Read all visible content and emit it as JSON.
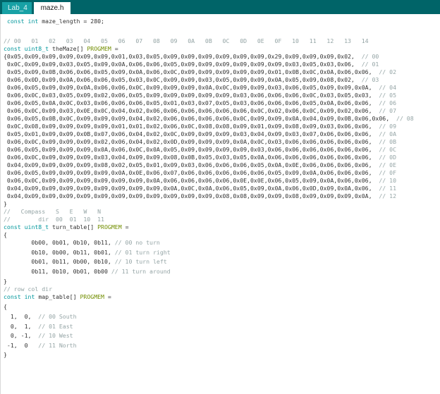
{
  "tabs": [
    {
      "label": "Lab_4",
      "active": false
    },
    {
      "label": "maze.h",
      "active": true
    }
  ],
  "code": {
    "maze_length": " const int maze_length = 280;",
    "col_comment": "// 00   01   02   03   04   05   06   07   08   09   0A   0B   0C   0D   0E   0F   10   11   12   13   14",
    "maze_decl": "const uint8_t theMaze[] PROGMEM =",
    "maze_rows": [
      "{0x05,0x09,0x09,0x09,0x09,0x09,0x01,0x03,0x05,0x09,0x09,0x09,0x09,0x09,0x09,0x29,0x09,0x09,0x09,0x02,  // 00",
      " 0x0C,0x09,0x09,0x03,0x05,0x09,0x0A,0x06,0x06,0x05,0x09,0x09,0x09,0x09,0x09,0x09,0x03,0x05,0x03,0x06,  // 01",
      " 0x05,0x09,0x0B,0x06,0x06,0x05,0x09,0x0A,0x06,0x0C,0x09,0x09,0x09,0x09,0x09,0x01,0x0B,0x0C,0x0A,0x06,0x06,  // 02",
      " 0x06,0x0D,0x09,0x0A,0x06,0x06,0x05,0x03,0x0C,0x09,0x09,0x03,0x05,0x09,0x09,0x0A,0x05,0x09,0x08,0x02,  // 03",
      " 0x06,0x05,0x09,0x09,0x0A,0x06,0x06,0x0C,0x09,0x09,0x09,0x0A,0x0C,0x09,0x09,0x03,0x06,0x05,0x09,0x09,0x0A,  // 04",
      " 0x06,0x0C,0x03,0x05,0x09,0x02,0x06,0x05,0x09,0x09,0x09,0x09,0x09,0x03,0x06,0x06,0x06,0x0C,0x03,0x05,0x03,  // 05",
      " 0x06,0x05,0x0A,0x0C,0x03,0x06,0x06,0x06,0x05,0x01,0x03,0x07,0x05,0x03,0x06,0x06,0x06,0x05,0x0A,0x06,0x06,  // 06",
      " 0x06,0x0C,0x09,0x03,0x0E,0x0C,0x04,0x02,0x06,0x06,0x06,0x06,0x06,0x06,0x0C,0x02,0x06,0x0C,0x09,0x02,0x06,  // 07",
      " 0x06,0x05,0x0B,0x0C,0x09,0x09,0x09,0x04,0x02,0x06,0x06,0x06,0x06,0x0C,0x09,0x09,0x0A,0x04,0x09,0x0B,0x06,0x06,  // 08",
      " 0x0C,0x08,0x09,0x09,0x09,0x09,0x01,0x01,0x02,0x06,0x0C,0x08,0x08,0x09,0x01,0x09,0x08,0x09,0x03,0x06,0x06,  // 09",
      " 0x05,0x01,0x09,0x09,0x0B,0x07,0x06,0x04,0x02,0x0C,0x09,0x09,0x09,0x03,0x04,0x09,0x03,0x07,0x06,0x06,0x06,  // 0A",
      " 0x06,0x0C,0x09,0x09,0x09,0x02,0x06,0x04,0x02,0x0D,0x09,0x09,0x09,0x0A,0x0C,0x03,0x06,0x06,0x06,0x06,0x06,  // 0B",
      " 0x06,0x05,0x09,0x09,0x09,0x0A,0x06,0x0C,0x0A,0x05,0x09,0x09,0x09,0x09,0x03,0x06,0x06,0x06,0x06,0x06,0x06,  // 0C",
      " 0x06,0x0C,0x09,0x09,0x09,0x03,0x04,0x09,0x09,0x08,0x0B,0x05,0x03,0x05,0x0A,0x06,0x06,0x06,0x06,0x06,0x06,  // 0D",
      " 0x04,0x09,0x09,0x09,0x09,0x08,0x02,0x05,0x01,0x09,0x03,0x06,0x06,0x06,0x05,0x0A,0x0E,0x06,0x06,0x06,0x06,  // 0E",
      " 0x06,0x05,0x09,0x09,0x09,0x09,0x0A,0x0E,0x06,0x07,0x06,0x06,0x06,0x06,0x06,0x05,0x09,0x0A,0x06,0x06,0x06,  // 0F",
      " 0x06,0x0C,0x09,0x09,0x09,0x09,0x09,0x09,0x0A,0x06,0x06,0x06,0x06,0x0E,0x0E,0x06,0x05,0x09,0x0A,0x06,0x06,  // 10",
      " 0x04,0x09,0x09,0x09,0x09,0x09,0x09,0x09,0x09,0x0A,0x0C,0x0A,0x06,0x05,0x09,0x0A,0x06,0x0D,0x09,0x0A,0x06,  // 11",
      " 0x04,0x09,0x09,0x09,0x09,0x09,0x09,0x09,0x09,0x09,0x09,0x09,0x08,0x08,0x09,0x09,0x08,0x09,0x09,0x09,0x0A,  // 12"
    ],
    "maze_close": "}",
    "compass_comment": "//   Compass   S   E   W   N",
    "dir_comment": "//        dir  00  01  10  11",
    "turn_decl": "const uint8_t turn_table[] PROGMEM =",
    "turn_open": "{",
    "turn_rows": [
      "        0b00, 0b01, 0b10, 0b11, // 00 no turn",
      "        0b10, 0b00, 0b11, 0b01, // 01 turn right",
      "        0b01, 0b11, 0b00, 0b10, // 10 turn left",
      "        0b11, 0b10, 0b01, 0b00 // 11 turn around"
    ],
    "turn_close": "}",
    "rowcol_comment": "// row col dir",
    "map_decl": "const int map_table[] PROGMEM =",
    "map_open": "{",
    "map_rows": [
      "  1,  0,  // 00 South",
      "  0,  1,  // 01 East",
      "  0, -1,  // 10 West",
      " -1,  0   // 11 North"
    ],
    "map_close": "}"
  },
  "colors": {
    "tabbar_bg": "#006468",
    "inactive_tab_bg": "#17a1a5",
    "keyword": "#00979c",
    "comment": "#95a5a6",
    "progmem": "#728e00"
  }
}
